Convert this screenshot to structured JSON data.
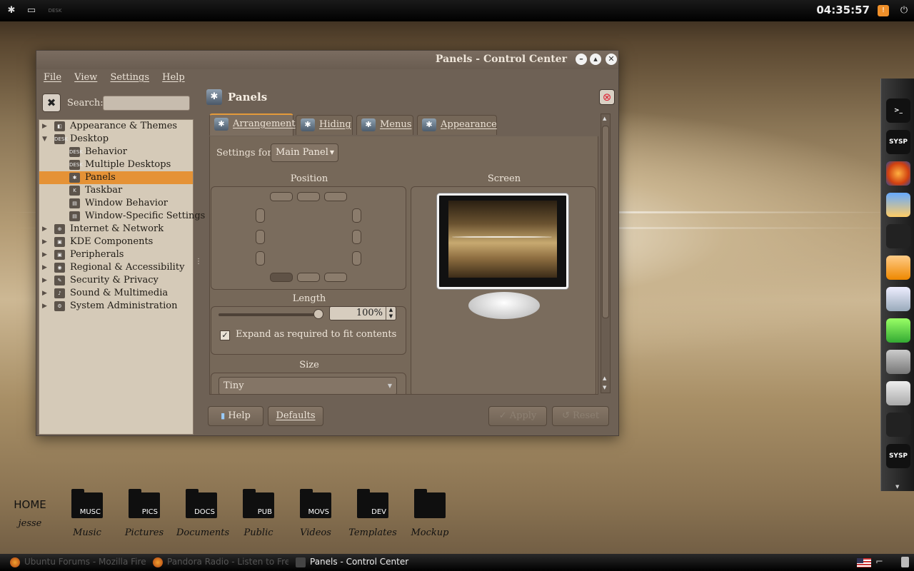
{
  "top_panel": {
    "clock": "04:35:57",
    "desk_label": "DESK"
  },
  "window": {
    "title": "Panels - Control Center",
    "menu": [
      "File",
      "View",
      "Settings",
      "Help"
    ],
    "search_label": "Search:",
    "search_value": "",
    "tree": [
      {
        "label": "Appearance & Themes",
        "level": 0,
        "arrow": "▶",
        "icon": "◧"
      },
      {
        "label": "Desktop",
        "level": 0,
        "arrow": "▼",
        "icon": "DESK"
      },
      {
        "label": "Behavior",
        "level": 1,
        "icon": "DESK"
      },
      {
        "label": "Multiple Desktops",
        "level": 1,
        "icon": "DESK"
      },
      {
        "label": "Panels",
        "level": 1,
        "icon": "✱",
        "selected": true
      },
      {
        "label": "Taskbar",
        "level": 1,
        "icon": "K"
      },
      {
        "label": "Window Behavior",
        "level": 1,
        "icon": "▤"
      },
      {
        "label": "Window-Specific Settings",
        "level": 1,
        "icon": "▤"
      },
      {
        "label": "Internet & Network",
        "level": 0,
        "arrow": "▶",
        "icon": "⊕"
      },
      {
        "label": "KDE Components",
        "level": 0,
        "arrow": "▶",
        "icon": "▣"
      },
      {
        "label": "Peripherals",
        "level": 0,
        "arrow": "▶",
        "icon": "▣"
      },
      {
        "label": "Regional & Accessibility",
        "level": 0,
        "arrow": "▶",
        "icon": "◉"
      },
      {
        "label": "Security & Privacy",
        "level": 0,
        "arrow": "▶",
        "icon": "✎"
      },
      {
        "label": "Sound & Multimedia",
        "level": 0,
        "arrow": "▶",
        "icon": "♪"
      },
      {
        "label": "System Administration",
        "level": 0,
        "arrow": "▶",
        "icon": "⚙"
      }
    ],
    "pane_title": "Panels",
    "tabs": [
      "Arrangement",
      "Hiding",
      "Menus",
      "Appearance"
    ],
    "settings_for_label": "Settings for:",
    "settings_for_value": "Main Panel",
    "position_label": "Position",
    "screen_label": "Screen",
    "length_label": "Length",
    "length_value": "100%",
    "length_fraction": 1.0,
    "expand_label": "Expand as required to fit contents",
    "expand_checked": true,
    "size_label": "Size",
    "size_value": "Tiny",
    "buttons": {
      "help": "Help",
      "defaults": "Defaults",
      "apply": "Apply",
      "reset": "Reset"
    }
  },
  "dock": [
    {
      "name": "terminal-icon",
      "label": ">_"
    },
    {
      "name": "sysp-icon",
      "label": "SYSP"
    },
    {
      "name": "firefox-icon",
      "label": ""
    },
    {
      "name": "image-viewer-icon",
      "label": ""
    },
    {
      "name": "inkscape-icon",
      "label": ""
    },
    {
      "name": "package-icon",
      "label": ""
    },
    {
      "name": "document-icon",
      "label": ""
    },
    {
      "name": "gem-icon",
      "label": ""
    },
    {
      "name": "gimp-icon",
      "label": ""
    },
    {
      "name": "settings-window-icon",
      "label": ""
    },
    {
      "name": "pen-icon",
      "label": ""
    },
    {
      "name": "sysp-icon-2",
      "label": "SYSP"
    }
  ],
  "desktop_icons": [
    {
      "label": "jesse",
      "tag": "HOME"
    },
    {
      "label": "Music",
      "tag": "MUSC"
    },
    {
      "label": "Pictures",
      "tag": "PICS"
    },
    {
      "label": "Documents",
      "tag": "DOCS"
    },
    {
      "label": "Public",
      "tag": "PUB"
    },
    {
      "label": "Videos",
      "tag": "MOVS"
    },
    {
      "label": "Templates",
      "tag": "DEV"
    },
    {
      "label": "Mockup",
      "tag": ""
    }
  ],
  "taskbar": [
    {
      "label": "Ubuntu Forums - Mozilla Firef",
      "active": false
    },
    {
      "label": "Pandora Radio - Listen to Free",
      "active": false
    },
    {
      "label": "Panels - Control Center",
      "active": true
    }
  ],
  "colors": {
    "accent": "#e59236",
    "window_bg": "#6e6155",
    "tree_bg": "#d5cab8"
  }
}
